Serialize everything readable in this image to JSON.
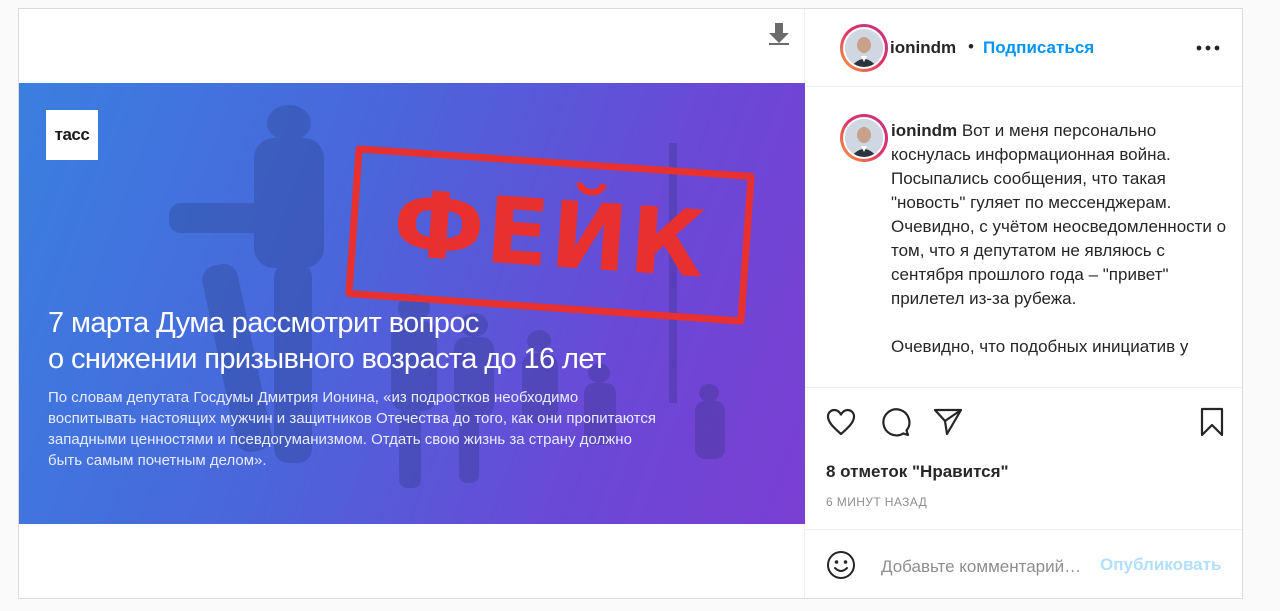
{
  "post": {
    "media": {
      "logo_text": "тасс",
      "headline_line1": "7 марта Дума рассмотрит вопрос",
      "headline_line2": "о снижении призывного возраста до 16 лет",
      "body_line1": "По словам депутата Госдумы Дмитрия Ионина, «из подростков необходимо",
      "body_line2": "воспитывать настоящих мужчин и защитников Отечества до того, как они пропитаются",
      "body_line3": "западными ценностями и псевдогуманизмом. Отдать свою жизнь за страну должно",
      "body_line4": "быть самым почетным делом».",
      "stamp_text": "ФЕЙК",
      "gradient_colors": [
        "#3a7fe0",
        "#6b48d6",
        "#7a3fd3"
      ],
      "stamp_color": "#e8302f"
    },
    "header": {
      "username": "ionindm",
      "separator": "•",
      "follow_label": "Подписаться",
      "more_icon": "more-horizontal-icon"
    },
    "caption": {
      "username": "ionindm",
      "text": "Вот и меня персонально коснулась информационная война. Посыпались сообщения, что такая \"новость\" гуляет по мессенджерам. Очевидно, с учётом неосведомленности о том, что я депутатом не являюсь с сентября прошлого года – \"привет\" прилетел из-за рубежа.\n\nОчевидно, что подобных инициатив у"
    },
    "actions": {
      "icons": [
        "heart-icon",
        "comment-icon",
        "share-icon",
        "bookmark-icon"
      ],
      "likes_label": "8 отметок \"Нравится\"",
      "time_label": "6 МИНУТ НАЗАД"
    },
    "comment": {
      "placeholder": "Добавьте комментарий…",
      "publish_label": "Опубликовать"
    },
    "colors": {
      "accent": "#0095f6",
      "publish_disabled": "#b2dffc",
      "muted": "#8e8e8e"
    }
  }
}
